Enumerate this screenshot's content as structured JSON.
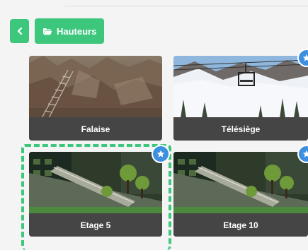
{
  "toolbar": {
    "back_icon": "chevron-left-icon",
    "folder_icon": "folder-open-icon",
    "breadcrumb_label": "Hauteurs"
  },
  "colors": {
    "accent": "#3cc77d",
    "star_badge": "#3d8fe0",
    "caption_bg": "#454545"
  },
  "cards": [
    {
      "label": "Falaise",
      "favorite": false,
      "selected": false
    },
    {
      "label": "Télésiège",
      "favorite": true,
      "selected": false
    },
    {
      "label": "Etage 5",
      "favorite": true,
      "selected": true
    },
    {
      "label": "Etage 10",
      "favorite": true,
      "selected": false
    }
  ]
}
